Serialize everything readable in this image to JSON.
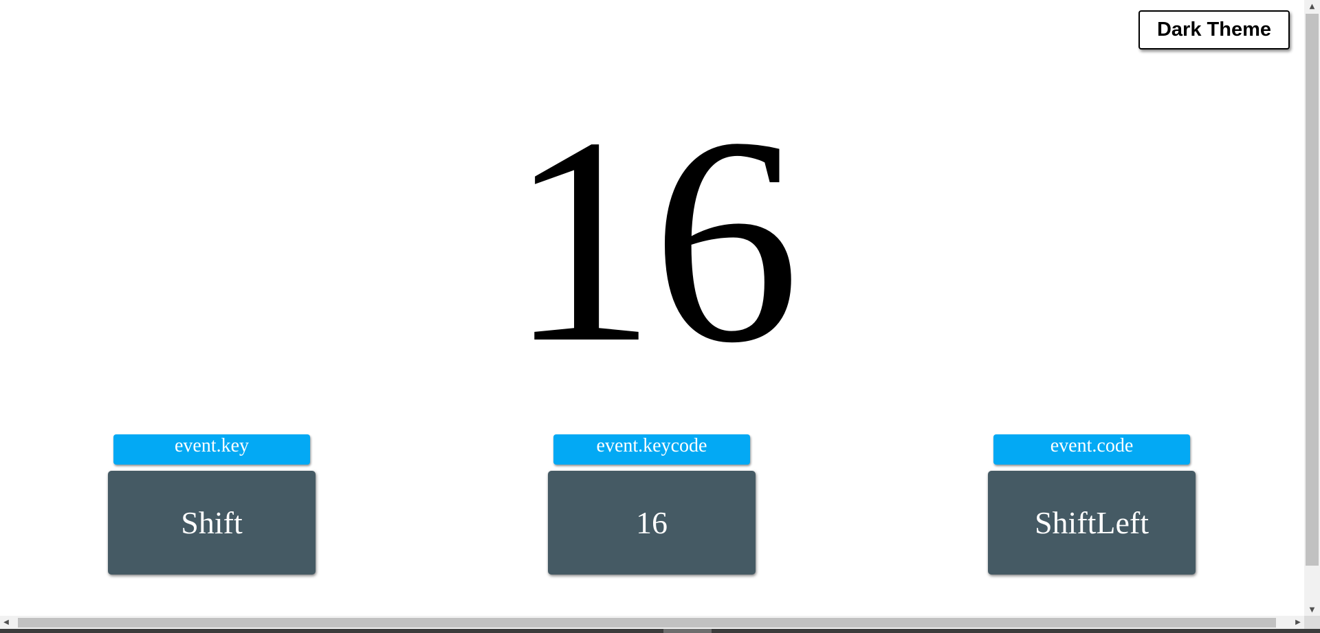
{
  "theme_button": {
    "label": "Dark Theme"
  },
  "display": {
    "keycode": "16"
  },
  "cards": [
    {
      "label": "event.key",
      "value": "Shift"
    },
    {
      "label": "event.keycode",
      "value": "16"
    },
    {
      "label": "event.code",
      "value": "ShiftLeft"
    }
  ],
  "colors": {
    "label_bg": "#03a9f4",
    "value_bg": "#455a64",
    "page_bg": "#ffffff"
  },
  "scrollbars": {
    "up_arrow_icon": "▲",
    "down_arrow_icon": "▼",
    "left_arrow_icon": "◀",
    "right_arrow_icon": "▶"
  }
}
